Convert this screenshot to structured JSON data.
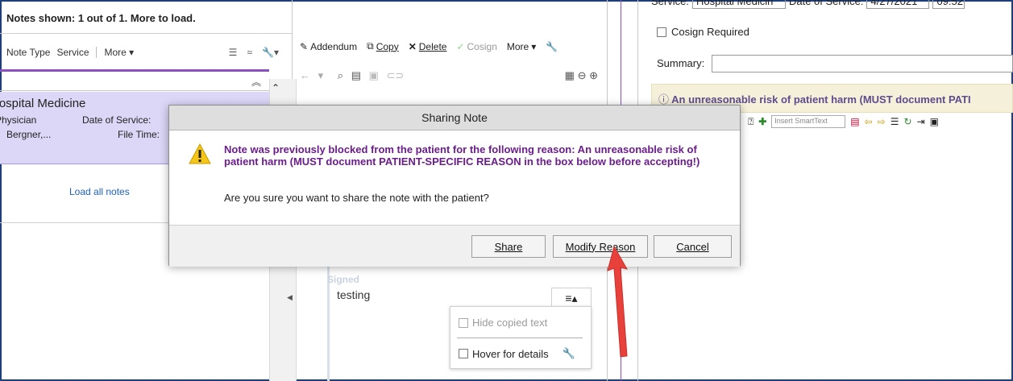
{
  "left": {
    "notes_shown": "Notes shown: 1 out of 1.  More to load.",
    "toolbar": {
      "note_type": "Note Type",
      "service": "Service",
      "more": "More"
    },
    "card": {
      "service": "Hospital Medicine",
      "role": "Physician",
      "author": "Bergner,...",
      "date_label": "Date of Service:",
      "file_label": "File Time:"
    },
    "load_all": "Load all notes"
  },
  "middle": {
    "toolbar": {
      "addendum": "Addendum",
      "copy": "Copy",
      "delete": "Delete",
      "cosign": "Cosign",
      "more": "More"
    },
    "signed": "Signed",
    "body_text": "testing",
    "menu": {
      "hide_copied": "Hide copied text",
      "hover_details": "Hover for details"
    }
  },
  "right": {
    "service_label": "Service:",
    "service_value": "Hospital Medicin",
    "date_label": "Date of Service:",
    "date_value": "4/27/2021",
    "time_value": "09:52",
    "cosign_required": "Cosign Required",
    "summary_label": "Summary:",
    "warning_banner": "An unreasonable risk of patient harm (MUST document PATI",
    "insert_smarttext": "Insert SmartText"
  },
  "dialog": {
    "title": "Sharing Note",
    "message": "Note was previously blocked from the patient for the following reason: An unreasonable risk of patient harm (MUST document PATIENT-SPECIFIC REASON in the box below before accepting!)",
    "question": "Are you sure you want to share the note with the patient?",
    "buttons": {
      "share": "Share",
      "modify": "Modify Reason",
      "cancel": "Cancel"
    }
  },
  "colors": {
    "accent_purple": "#8a4fc1",
    "dialog_message": "#6b1e8a",
    "arrow_red": "#e8403a",
    "card_bg": "#dcd6f7"
  }
}
